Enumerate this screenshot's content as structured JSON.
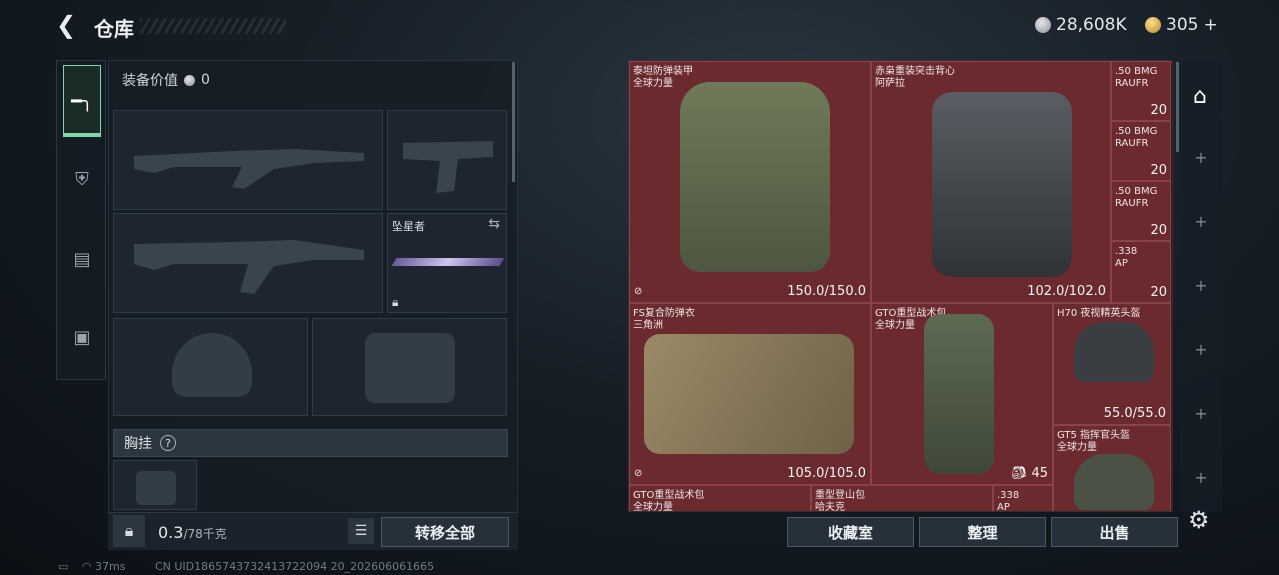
{
  "header": {
    "title": "仓库",
    "currency_silver": "28,608K",
    "currency_gold": "305",
    "add_label": "+"
  },
  "equipment": {
    "value_label": "装备价值",
    "value": "0",
    "pistol_slot_name": "坠星者",
    "chest_rig_label": "胸挂",
    "help": "?",
    "weight_current": "0.3",
    "weight_max": "/78千克",
    "transfer_all": "转移全部"
  },
  "storage": {
    "items": [
      {
        "name": "泰坦防弹装甲",
        "sub": "全球力量",
        "dur": "150.0/150.0"
      },
      {
        "name": "赤枭重装突击背心",
        "sub": "阿萨拉",
        "dur": "102.0/102.0"
      },
      {
        "name": "FS复合防弹衣",
        "sub": "三角洲",
        "dur": "105.0/105.0"
      },
      {
        "name": "GTO重型战术包",
        "sub": "全球力量",
        "dur": "45"
      },
      {
        "name": "H70 夜视精英头盔",
        "sub": "",
        "dur": "55.0/55.0"
      },
      {
        "name": "GT5 指挥官头盔",
        "sub": "全球力量",
        "dur": ""
      },
      {
        "name": "GTO重型战术包",
        "sub": "全球力量",
        "dur": ""
      },
      {
        "name": "重型登山包",
        "sub": "哈夫克",
        "dur": ""
      },
      {
        "name": ".338",
        "sub": "AP",
        "dur": ""
      }
    ],
    "ammo": [
      {
        "name": ".50 BMG",
        "sub": "RAUFR",
        "count": "20"
      },
      {
        "name": ".50 BMG",
        "sub": "RAUFR",
        "count": "20"
      },
      {
        "name": ".50 BMG",
        "sub": "RAUFR",
        "count": "20"
      },
      {
        "name": ".338",
        "sub": "AP",
        "count": "20"
      }
    ],
    "buttons": {
      "collection": "收藏室",
      "sort": "整理",
      "sell": "出售"
    }
  },
  "footer": {
    "ping": "37ms",
    "uid": "CN UID1865743732413722094 20_202606061665"
  }
}
